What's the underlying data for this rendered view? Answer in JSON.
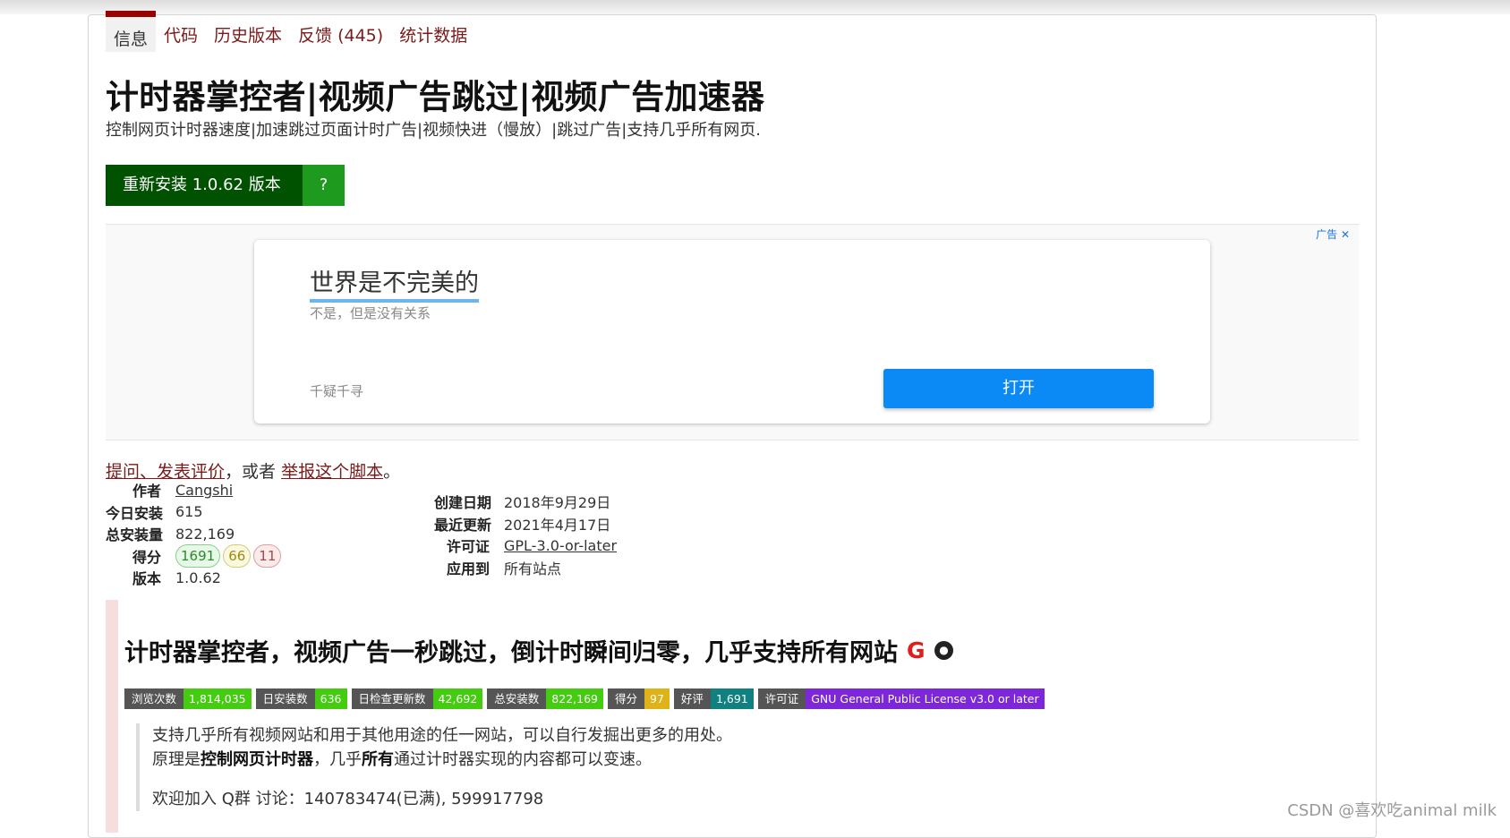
{
  "tabs": [
    "信息",
    "代码",
    "历史版本",
    "反馈 (445)",
    "统计数据"
  ],
  "script": {
    "title": "计时器掌控者|视频广告跳过|视频广告加速器",
    "subtitle": "控制网页计时器速度|加速跳过页面计时广告|视频快进（慢放）|跳过广告|支持几乎所有网页."
  },
  "install": {
    "label": "重新安装 1.0.62 版本",
    "help": "?"
  },
  "ad": {
    "tag": "广告",
    "close": "✕",
    "headline": "世界是不完美的",
    "description": "不是，但是没有关系",
    "source": "千疑千寻",
    "button": "打开"
  },
  "feedback": {
    "link1": "提问、发表评价",
    "middle": "，或者 ",
    "link2": "举报这个脚本",
    "end": "。"
  },
  "meta_left": {
    "author_label": "作者",
    "author": "Cangshi",
    "daily_label": "今日安装",
    "daily": "615",
    "total_label": "总安装量",
    "total": "822,169",
    "score_label": "得分",
    "score_good": "1691",
    "score_ok": "66",
    "score_bad": "11",
    "version_label": "版本",
    "version": "1.0.62"
  },
  "meta_right": {
    "created_label": "创建日期",
    "created": "2018年9月29日",
    "updated_label": "最近更新",
    "updated": "2021年4月17日",
    "license_label": "许可证",
    "license": "GPL-3.0-or-later",
    "applies_label": "应用到",
    "applies": "所有站点"
  },
  "description": {
    "title": "计时器掌控者，视频广告一秒跳过，倒计时瞬间归零，几乎支持所有网站",
    "greasy_icon": "G",
    "github_icon": "github-icon",
    "badges": [
      {
        "label": "浏览次数",
        "value": "1,814,035",
        "color": "#4c1"
      },
      {
        "label": "日安装数",
        "value": "636",
        "color": "#4c1"
      },
      {
        "label": "日检查更新数",
        "value": "42,692",
        "color": "#4c1"
      },
      {
        "label": "总安装数",
        "value": "822,169",
        "color": "#4c1"
      },
      {
        "label": "得分",
        "value": "97",
        "color": "#dfb317"
      },
      {
        "label": "好评",
        "value": "1,691",
        "color": "#108080"
      },
      {
        "label": "许可证",
        "value": "GNU General Public License v3.0 or later",
        "color": "#7e26d9"
      }
    ],
    "line1": "支持几乎所有视频网站和用于其他用途的任一网站，可以自行发掘出更多的用处。",
    "line2_a": "原理是",
    "line2_b": "控制网页计时器",
    "line2_c": "，几乎",
    "line2_d": "所有",
    "line2_e": "通过计时器实现的内容都可以变速。",
    "line3": "欢迎加入 Q群 讨论：140783474(已满), 599917798"
  },
  "watermark": "CSDN @喜欢吃animal milk"
}
